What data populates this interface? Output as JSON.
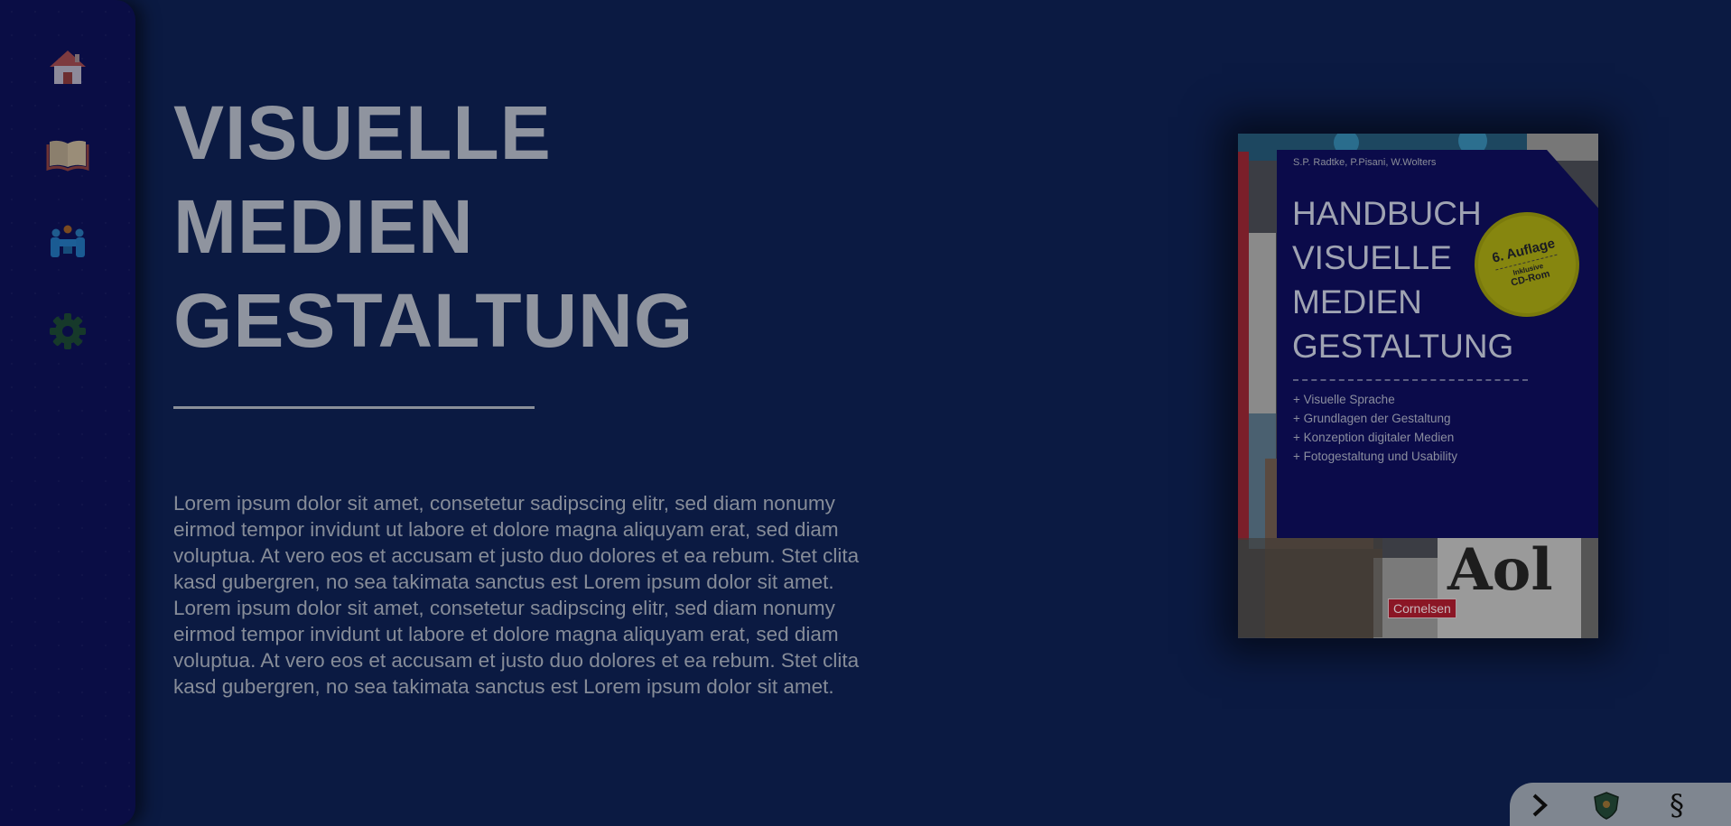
{
  "sidebar": {
    "items": [
      {
        "icon": "home-icon"
      },
      {
        "icon": "open-book-icon"
      },
      {
        "icon": "people-meeting-icon"
      },
      {
        "icon": "gear-icon"
      }
    ]
  },
  "main": {
    "title_lines": [
      "VISUELLE",
      "MEDIEN",
      "GESTALTUNG"
    ],
    "body": "Lorem ipsum dolor sit amet, consetetur sadipscing elitr, sed diam nonumy eirmod tempor invidunt ut labore et dolore magna aliquyam erat, sed diam voluptua. At vero eos et accusam et justo duo dolores et ea rebum. Stet clita kasd gubergren, no sea takimata sanctus est Lorem ipsum dolor sit amet. Lorem ipsum dolor sit amet, consetetur sadipscing elitr, sed diam nonumy eirmod tempor invidunt ut labore et dolore magna aliquyam erat, sed diam voluptua. At vero eos et accusam et justo duo dolores et ea rebum. Stet clita kasd gubergren, no sea takimata sanctus est Lorem ipsum dolor sit amet."
  },
  "book": {
    "authors": "S.P. Radtke, P.Pisani, W.Wolters",
    "title_lines": [
      "HANDBUCH",
      "VISUELLE",
      "MEDIEN",
      "GESTALTUNG"
    ],
    "badge": {
      "edition": "6. Auflage",
      "inclusive": "Inklusive",
      "media": "CD-Rom"
    },
    "topics": [
      "+ Visuelle Sprache",
      "+ Grundlagen der Gestaltung",
      "+ Konzeption digitaler Medien",
      "+ Fotogestaltung und Usability"
    ],
    "publisher": "Cornelsen"
  },
  "corner_bar": {
    "next_icon": "chevron-right-icon",
    "shield_icon": "shield-icon",
    "legal_symbol": "§"
  },
  "colors": {
    "background": "#0b1a42",
    "sidebar": "#0a0d45",
    "title": "#8f949f",
    "text": "#868c98"
  }
}
